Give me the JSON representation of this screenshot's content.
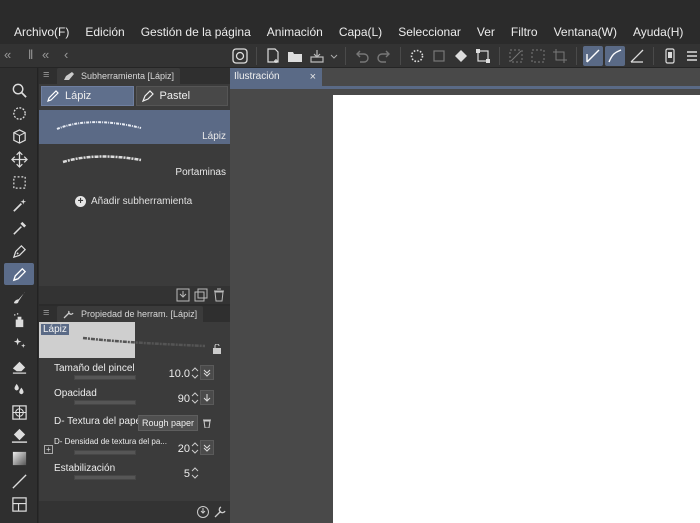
{
  "menubar": {
    "items": [
      "Archivo(F)",
      "Edición",
      "Gestión de la página",
      "Animación",
      "Capa(L)",
      "Seleccionar",
      "Ver",
      "Filtro",
      "Ventana(W)",
      "Ayuda(H)"
    ]
  },
  "toolbar": {
    "icons": [
      "app-logo-icon",
      "new-file-icon",
      "open-file-icon",
      "save-icon",
      "dropdown-icon",
      "undo-icon",
      "redo-icon",
      "busy-spinner-icon",
      "clear-icon",
      "fill-icon",
      "transform-icon",
      "deselect-icon",
      "invert-selection-icon",
      "crop-icon",
      "snap-ruler-icon",
      "snap-special-ruler-icon",
      "snap-grid-icon",
      "device-icon",
      "menu-icon"
    ]
  },
  "tools": [
    "zoom",
    "rotate",
    "object",
    "move",
    "selection",
    "auto-select",
    "eyedropper",
    "pen",
    "pencil",
    "brush",
    "airbrush",
    "decoration",
    "eraser",
    "blend",
    "figure",
    "fill",
    "gradient",
    "line",
    "frame"
  ],
  "subtool_panel": {
    "tab_label": "Subherramienta [Lápiz]",
    "groups": [
      {
        "label": "Lápiz",
        "active": true
      },
      {
        "label": "Pastel",
        "active": false
      }
    ],
    "brushes": [
      {
        "label": "Lápiz",
        "selected": true
      },
      {
        "label": "Portaminas",
        "selected": false
      }
    ],
    "add_label": "Añadir subherramienta"
  },
  "property_panel": {
    "tab_label": "Propiedad de herram. [Lápiz]",
    "preview_label": "Lápiz",
    "properties": [
      {
        "name": "Tamaño del pincel",
        "value": "10.0"
      },
      {
        "name": "Opacidad",
        "value": "90"
      },
      {
        "name": "D- Textura del papel",
        "value": "Rough paper"
      },
      {
        "name": "D- Densidad de textura del pa...",
        "value": "20"
      },
      {
        "name": "Estabilización",
        "value": "5"
      }
    ]
  },
  "document": {
    "tab_label": "Ilustración",
    "close_glyph": "×"
  },
  "colors": {
    "accent": "#5b6a86",
    "panel": "#3b3b3b",
    "canvas_bg": "#494949",
    "paper": "#ffffff"
  }
}
